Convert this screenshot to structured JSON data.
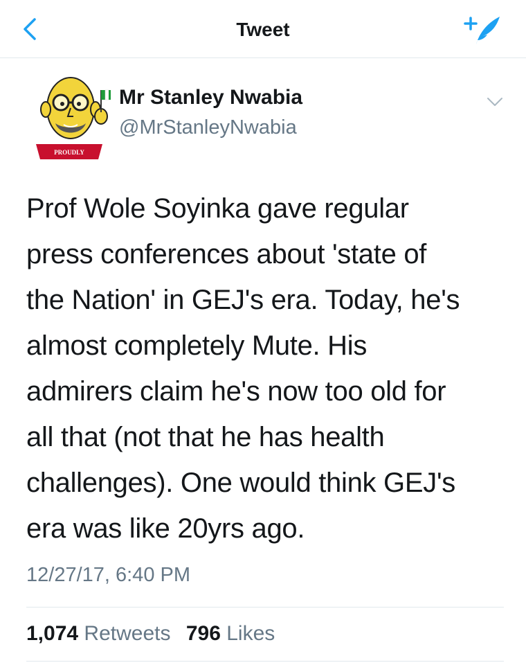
{
  "nav": {
    "title": "Tweet",
    "back_icon": "chevron-left-icon",
    "compose_icon": "compose-tweet-icon",
    "accent": "#1da1f2"
  },
  "author": {
    "display_name": "Mr Stanley Nwabia",
    "handle": "@MrStanleyNwabia",
    "avatar_badge_text": "PROUDLY",
    "menu_icon": "chevron-down-icon"
  },
  "tweet": {
    "lines": [
      "Prof Wole Soyinka gave regular",
      "press conferences about 'state of",
      "the Nation' in GEJ's era. Today, he's",
      "almost completely Mute. His",
      "admirers claim he's now too old for",
      "all that (not that he has health",
      "challenges). One would think GEJ's",
      "era was like 20yrs ago."
    ],
    "timestamp": "12/27/17, 6:40 PM"
  },
  "stats": {
    "retweets_count": "1,074",
    "retweets_label": "Retweets",
    "likes_count": "796",
    "likes_label": "Likes"
  }
}
